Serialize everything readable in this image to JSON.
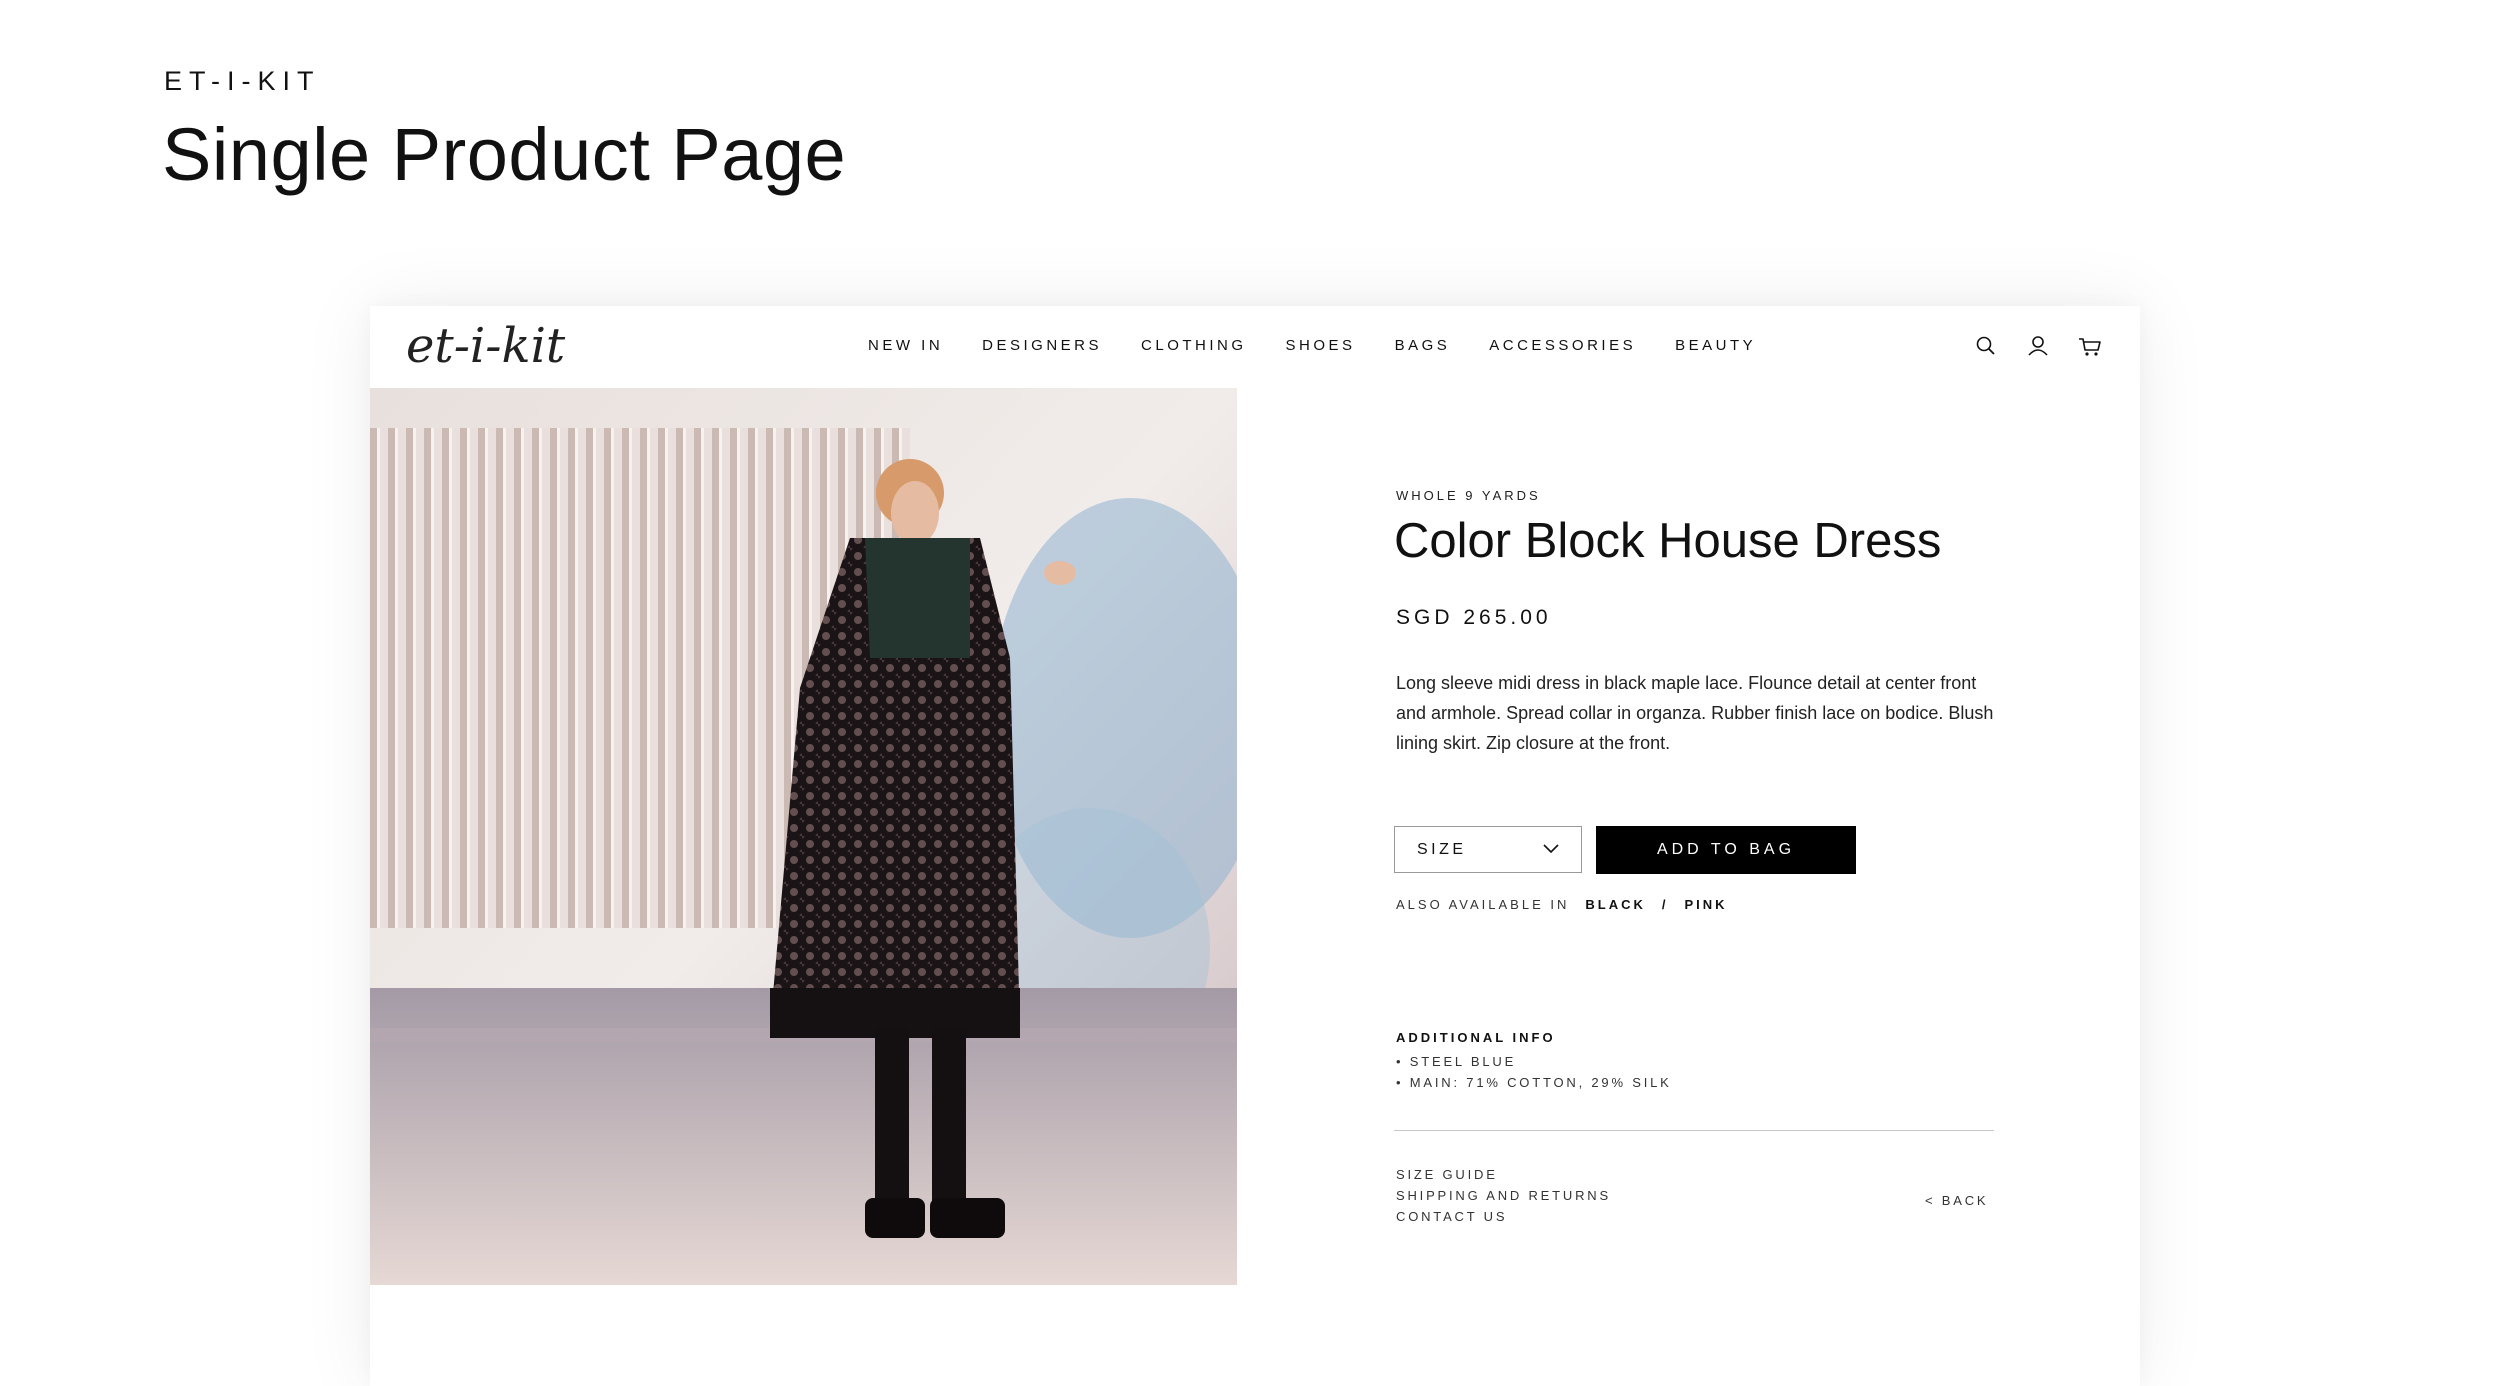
{
  "header": {
    "eyebrow": "ET-I-KIT",
    "title": "Single Product Page"
  },
  "site": {
    "logo_text": "et-i-kit",
    "nav": [
      "NEW IN",
      "DESIGNERS",
      "CLOTHING",
      "SHOES",
      "BAGS",
      "ACCESSORIES",
      "BEAUTY"
    ],
    "icons": [
      "search-icon",
      "user-icon",
      "cart-icon"
    ]
  },
  "product": {
    "brand": "WHOLE 9 YARDS",
    "name": "Color Block House Dress",
    "price": "SGD 265.00",
    "description": "Long sleeve midi dress in black maple lace. Flounce detail at center front and armhole. Spread collar in organza. Rubber finish lace on bodice. Blush lining skirt. Zip closure at the front.",
    "size_label": "SIZE",
    "add_to_bag": "ADD TO BAG",
    "also_available_label": "ALSO AVAILABLE IN",
    "also_available_colors": [
      "BLACK",
      "/",
      "PINK"
    ],
    "additional_info_title": "ADDITIONAL INFO",
    "additional_info": [
      "• STEEL BLUE",
      "• MAIN: 71% COTTON, 29% SILK"
    ],
    "links": [
      "SIZE GUIDE",
      "SHIPPING AND RETURNS",
      "CONTACT US"
    ],
    "back_label": "<  BACK"
  },
  "colors": {
    "accent": "#000000",
    "text": "#111111"
  }
}
